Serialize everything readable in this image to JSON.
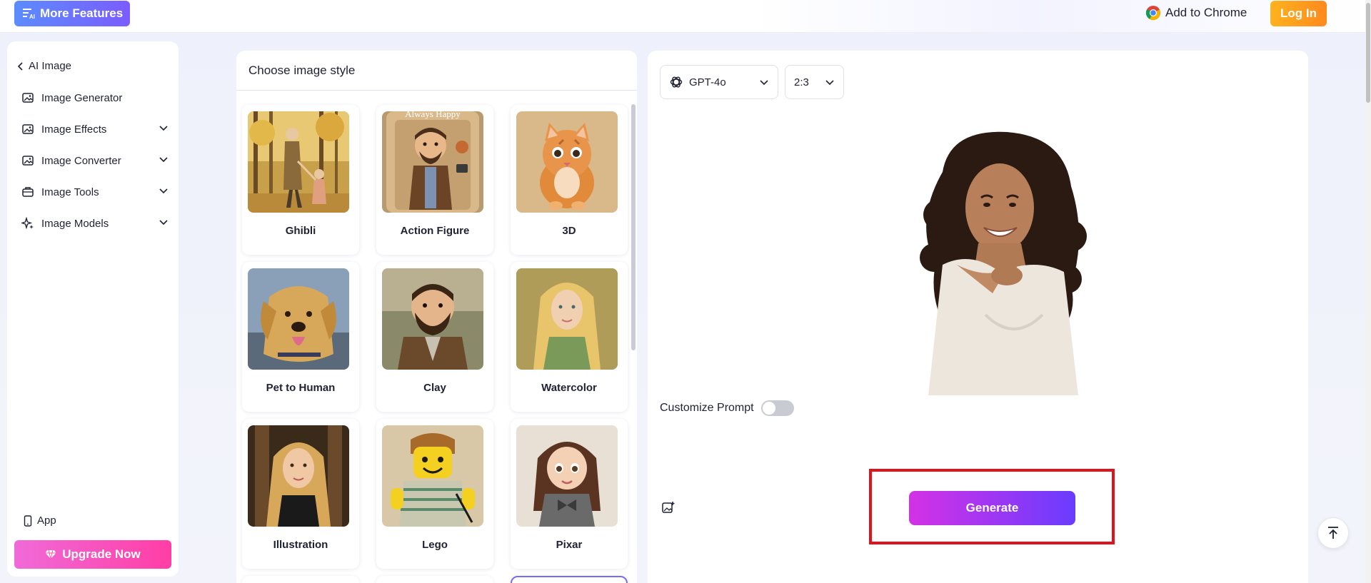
{
  "topbar": {
    "more_features": "More Features",
    "add_to_chrome": "Add to Chrome",
    "login": "Log In"
  },
  "sidebar": {
    "back_label": "AI Image",
    "items": [
      {
        "label": "Image Generator",
        "icon": "image-icon",
        "expandable": false
      },
      {
        "label": "Image Effects",
        "icon": "image-icon",
        "expandable": true
      },
      {
        "label": "Image Converter",
        "icon": "image-icon",
        "expandable": true
      },
      {
        "label": "Image Tools",
        "icon": "toolbox-icon",
        "expandable": true
      },
      {
        "label": "Image Models",
        "icon": "sparkle-icon",
        "expandable": true
      }
    ],
    "app_label": "App",
    "upgrade_label": "Upgrade Now"
  },
  "style_panel": {
    "title": "Choose image style",
    "styles": [
      {
        "label": "Ghibli"
      },
      {
        "label": "Action Figure"
      },
      {
        "label": "3D"
      },
      {
        "label": "Pet to Human"
      },
      {
        "label": "Clay"
      },
      {
        "label": "Watercolor"
      },
      {
        "label": "Illustration"
      },
      {
        "label": "Lego"
      },
      {
        "label": "Pixar"
      }
    ],
    "action_figure_banner": "Always Happy"
  },
  "generator": {
    "model": "GPT-4o",
    "ratio": "2:3",
    "customize_prompt": "Customize Prompt",
    "customize_enabled": false,
    "generate_label": "Generate"
  },
  "colors": {
    "brand_gradient_start": "#5b8cff",
    "brand_gradient_end": "#7b5cff",
    "login": "#ffa11e",
    "upgrade": "#ff3ea5",
    "generate_start": "#d431e6",
    "generate_end": "#6a3cff",
    "highlight": "#e0121d"
  }
}
